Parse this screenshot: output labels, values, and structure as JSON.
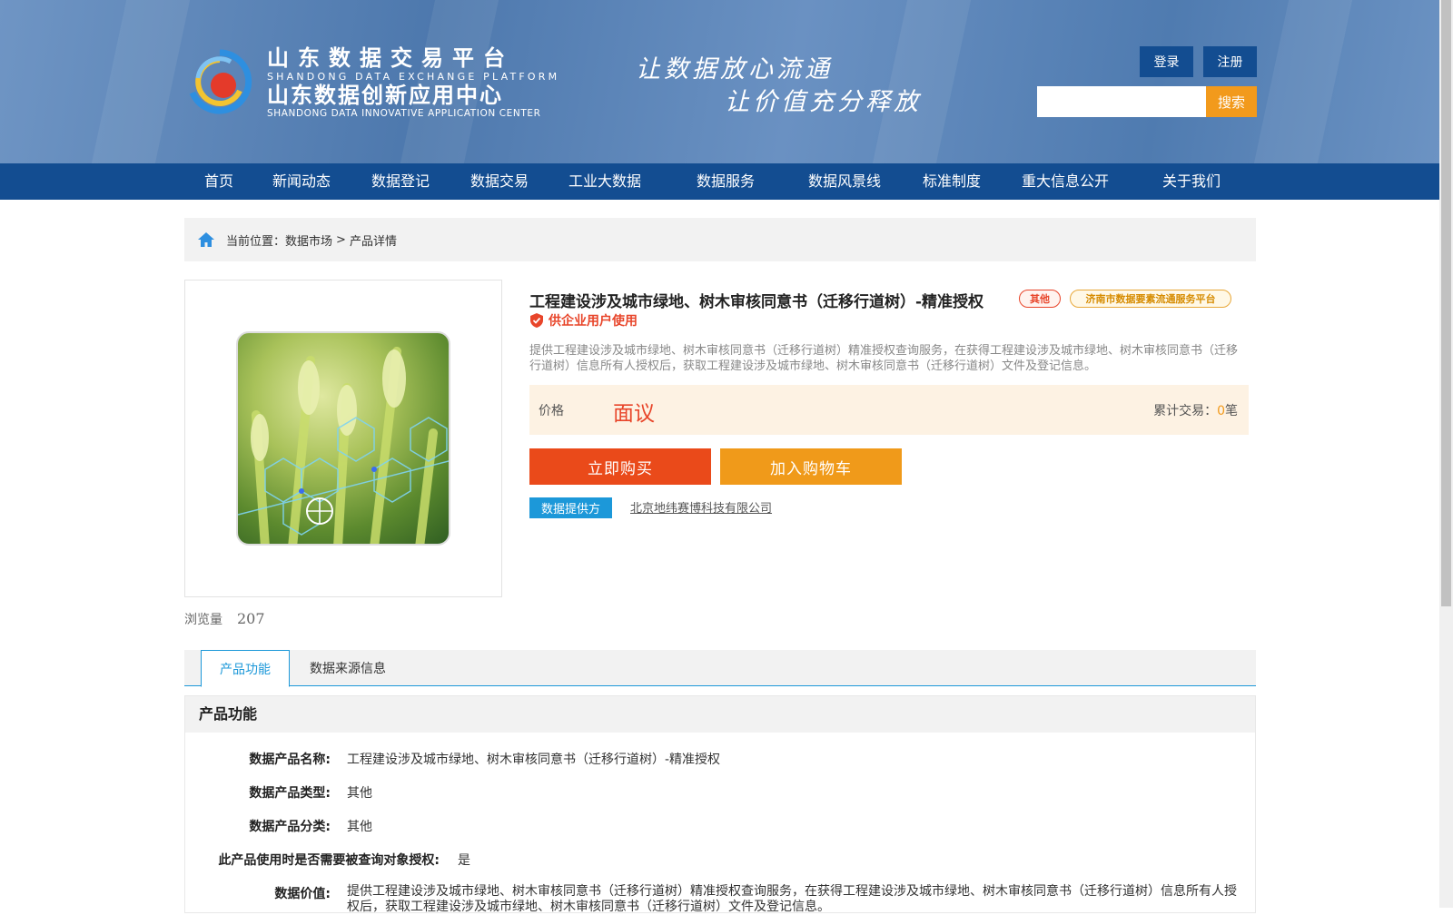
{
  "header": {
    "logo": {
      "cn_title": "山东数据交易平台",
      "en_title": "SHANDONG DATA EXCHANGE PLATFORM",
      "cn_subtitle": "山东数据创新应用中心",
      "en_subtitle": "SHANDONG DATA INNOVATIVE APPLICATION CENTER"
    },
    "slogan": {
      "line1": "让数据放心流通",
      "line2": "让价值充分释放"
    },
    "login_label": "登录",
    "register_label": "注册",
    "search": {
      "value": "",
      "button_label": "搜索"
    },
    "colors": {
      "header_blue": "#4d78ad",
      "nav_blue": "#134d91",
      "accent_orange": "#f29a1c"
    }
  },
  "nav": {
    "items": [
      {
        "label": "首页"
      },
      {
        "label": "新闻动态"
      },
      {
        "label": "数据登记"
      },
      {
        "label": "数据交易"
      },
      {
        "label": "工业大数据"
      },
      {
        "label": "数据服务"
      },
      {
        "label": "数据风景线"
      },
      {
        "label": "标准制度"
      },
      {
        "label": "重大信息公开"
      },
      {
        "label": "关于我们"
      }
    ]
  },
  "breadcrumb": {
    "icon": "home-icon",
    "prefix": "当前位置：",
    "items": [
      "数据市场",
      "产品详情"
    ],
    "separator": ">"
  },
  "product": {
    "image_icon": "wheat-data-image",
    "title": "工程建设涉及城市绿地、树木审核同意书（迁移行道树）-精准授权",
    "category_tag": "其他",
    "platform_tag": "济南市数据要素流通服务平台",
    "audience": "供企业用户使用",
    "description": "提供工程建设涉及城市绿地、树木审核同意书（迁移行道树）精准授权查询服务，在获得工程建设涉及城市绿地、树木审核同意书（迁移行道树）信息所有人授权后，获取工程建设涉及城市绿地、树木审核同意书（迁移行道树）文件及登记信息。",
    "price_label": "价格",
    "price_value": "面议",
    "trade_label": "累计交易：",
    "trade_count": "0",
    "trade_unit": "笔",
    "buy_label": "立即购买",
    "cart_label": "加入购物车",
    "provider_badge": "数据提供方",
    "provider_name": "北京地纬赛博科技有限公司",
    "views_label": "浏览量",
    "views_count": "207"
  },
  "tabs": [
    {
      "label": "产品功能",
      "active": true
    },
    {
      "label": "数据来源信息",
      "active": false
    }
  ],
  "details": {
    "heading": "产品功能",
    "rows": [
      {
        "key": "数据产品名称:",
        "value": "工程建设涉及城市绿地、树木审核同意书（迁移行道树）-精准授权"
      },
      {
        "key": "数据产品类型:",
        "value": "其他"
      },
      {
        "key": "数据产品分类:",
        "value": "其他"
      },
      {
        "key": "此产品使用时是否需要被查询对象授权:",
        "value": "是"
      },
      {
        "key": "数据价值:",
        "value": "提供工程建设涉及城市绿地、树木审核同意书（迁移行道树）精准授权查询服务，在获得工程建设涉及城市绿地、树木审核同意书（迁移行道树）信息所有人授权后，获取工程建设涉及城市绿地、树木审核同意书（迁移行道树）文件及登记信息。"
      }
    ]
  }
}
